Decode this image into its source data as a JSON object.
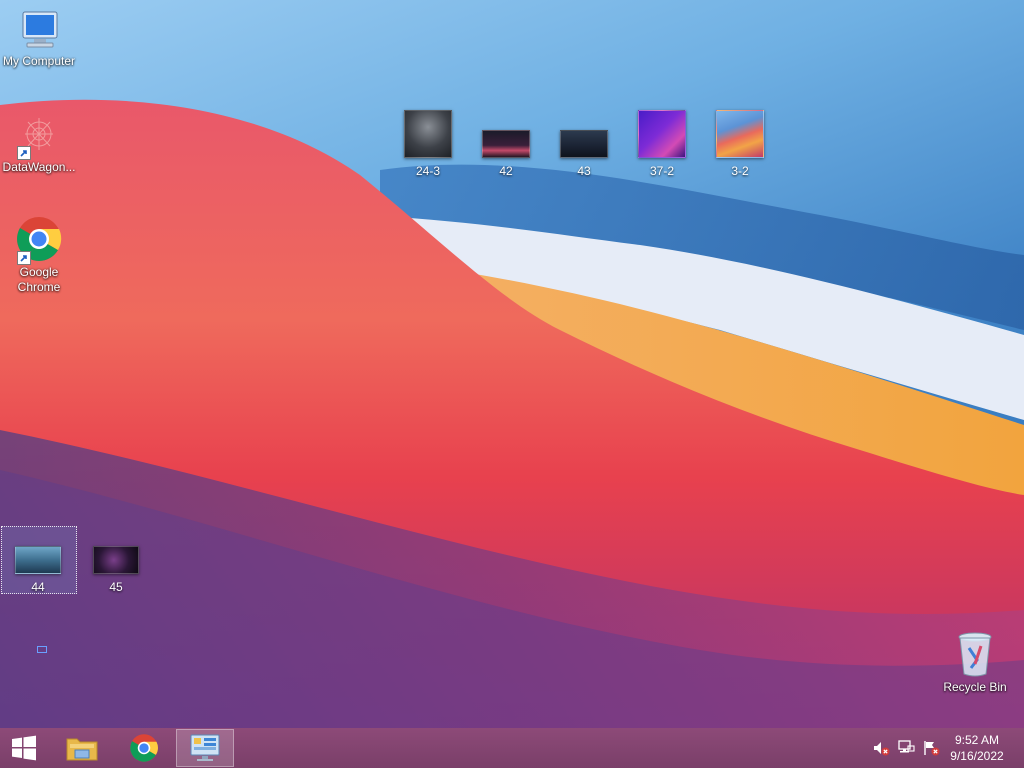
{
  "desktop_icons": {
    "my_computer": "My Computer",
    "datawagon": "DataWagon...",
    "chrome": "Google Chrome",
    "recycle_bin": "Recycle Bin"
  },
  "thumbnails": [
    {
      "label": "24-3"
    },
    {
      "label": "42"
    },
    {
      "label": "43"
    },
    {
      "label": "37-2"
    },
    {
      "label": "3-2"
    },
    {
      "label": "44"
    },
    {
      "label": "45"
    }
  ],
  "taskbar": {
    "time": "9:52 AM",
    "date": "9/16/2022"
  },
  "colors": {
    "taskbar": "#7a3f69",
    "sky": "#6fb0e3",
    "wave_red": "#e8414e",
    "wave_orange": "#f0a548"
  }
}
